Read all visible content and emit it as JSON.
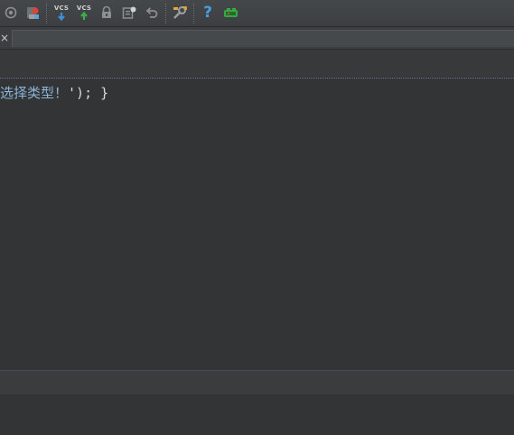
{
  "toolbar": {
    "icons": [
      "debug-icon",
      "attach-debugger-icon",
      "vcs-update-icon",
      "vcs-commit-icon",
      "lock-icon",
      "show-changes-icon",
      "revert-icon",
      "settings-wrench-icon",
      "help-icon",
      "plugin-icon"
    ],
    "vcs_update_label": "VCS",
    "vcs_commit_label": "VCS",
    "help_label": "?"
  },
  "tabs": {
    "close_label": "×"
  },
  "editor": {
    "code_text": "选择类型！",
    "code_suffix": "'); }"
  },
  "colors": {
    "background": "#333435",
    "toolbar": "#3c3f41",
    "string": "#8ab4d8",
    "punctuation": "#d7d9db",
    "vcs_update_arrow": "#3d8fd6",
    "vcs_commit_arrow": "#3fae49",
    "help": "#4a9fe0"
  }
}
